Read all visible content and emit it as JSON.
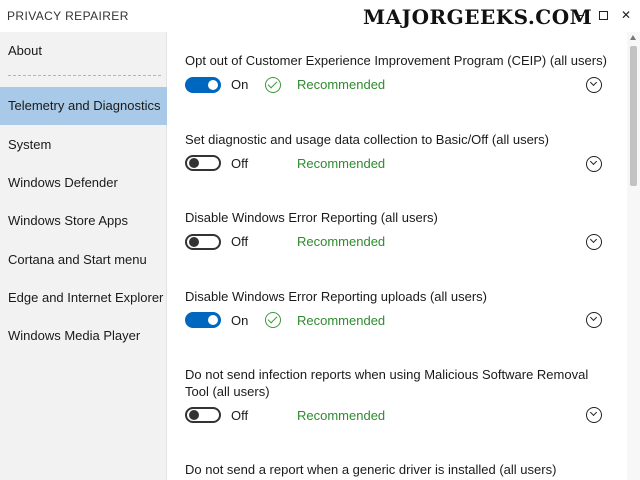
{
  "window": {
    "title": "PRIVACY REPAIRER",
    "watermark": "MAJORGEEKS.COM"
  },
  "sidebar": {
    "items": [
      {
        "label": "About",
        "active": false
      },
      {
        "label": "Telemetry and Diagnostics",
        "active": true
      },
      {
        "label": "System",
        "active": false
      },
      {
        "label": "Windows Defender",
        "active": false
      },
      {
        "label": "Windows Store Apps",
        "active": false
      },
      {
        "label": "Cortana and Start menu",
        "active": false
      },
      {
        "label": "Edge and Internet Explorer",
        "active": false
      },
      {
        "label": "Windows Media Player",
        "active": false
      }
    ]
  },
  "settings": [
    {
      "title": "Opt out of Customer Experience Improvement Program (CEIP) (all users)",
      "state": "On",
      "recommendation": "Recommended",
      "checked": true
    },
    {
      "title": "Set diagnostic and usage data collection to Basic/Off (all users)",
      "state": "Off",
      "recommendation": "Recommended",
      "checked": false
    },
    {
      "title": "Disable Windows Error Reporting (all users)",
      "state": "Off",
      "recommendation": "Recommended",
      "checked": false
    },
    {
      "title": "Disable Windows Error Reporting uploads (all users)",
      "state": "On",
      "recommendation": "Recommended",
      "checked": true
    },
    {
      "title": "Do not send infection reports when using Malicious Software Removal Tool (all users)",
      "state": "Off",
      "recommendation": "Recommended",
      "checked": false
    },
    {
      "title": "Do not send a report when a generic driver is installed (all users)",
      "state": "",
      "recommendation": "",
      "checked": false
    }
  ],
  "colors": {
    "accent": "#0067c0",
    "sidebar_active": "#a9c9e8",
    "recommended": "#2e8b2e"
  },
  "icons": {
    "check": "check-circle-icon",
    "expand": "chevron-down-circle-icon",
    "minimize": "minimize-icon",
    "maximize": "maximize-icon",
    "close": "close-icon"
  }
}
